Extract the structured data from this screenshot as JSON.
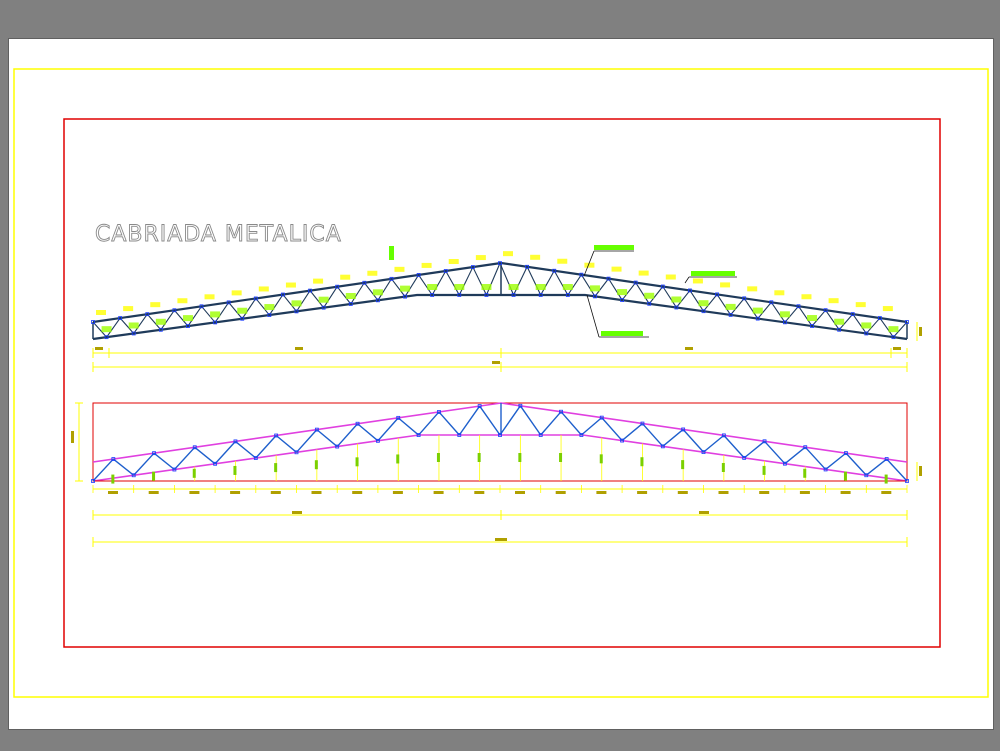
{
  "title": "CABRIADA METALICA",
  "colors": {
    "background": "#808080",
    "sheet": "#ffffff",
    "outer_frame": "#ffff00",
    "inner_frame": "#e00000",
    "truss_members": "#1f3a5a",
    "truss_diagonals": "#1e5fcc",
    "chord_outline": "#e040e0",
    "dimension_lines": "#ffff00",
    "annotations": "#66ff00",
    "node_markers": "#1a3cff"
  },
  "icons": {
    "node": "square-node-icon",
    "plate": "yellow-plate-icon"
  }
}
